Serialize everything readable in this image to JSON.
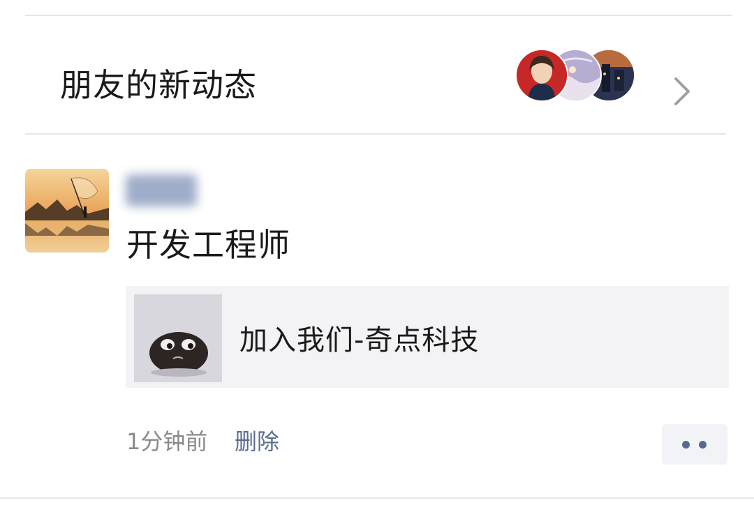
{
  "friends_updates": {
    "title": "朋友的新动态"
  },
  "post": {
    "author_name": "",
    "text": "开发工程师",
    "shared_link": {
      "title": "加入我们-奇点科技"
    },
    "time": "1分钟前",
    "delete_label": "删除"
  },
  "icons": {
    "chevron": "chevron-right-icon",
    "more": "more-dots-icon"
  },
  "colors": {
    "link_blue": "#5b6b8c",
    "time_gray": "#8a8a8a",
    "card_bg": "#f3f3f5"
  }
}
